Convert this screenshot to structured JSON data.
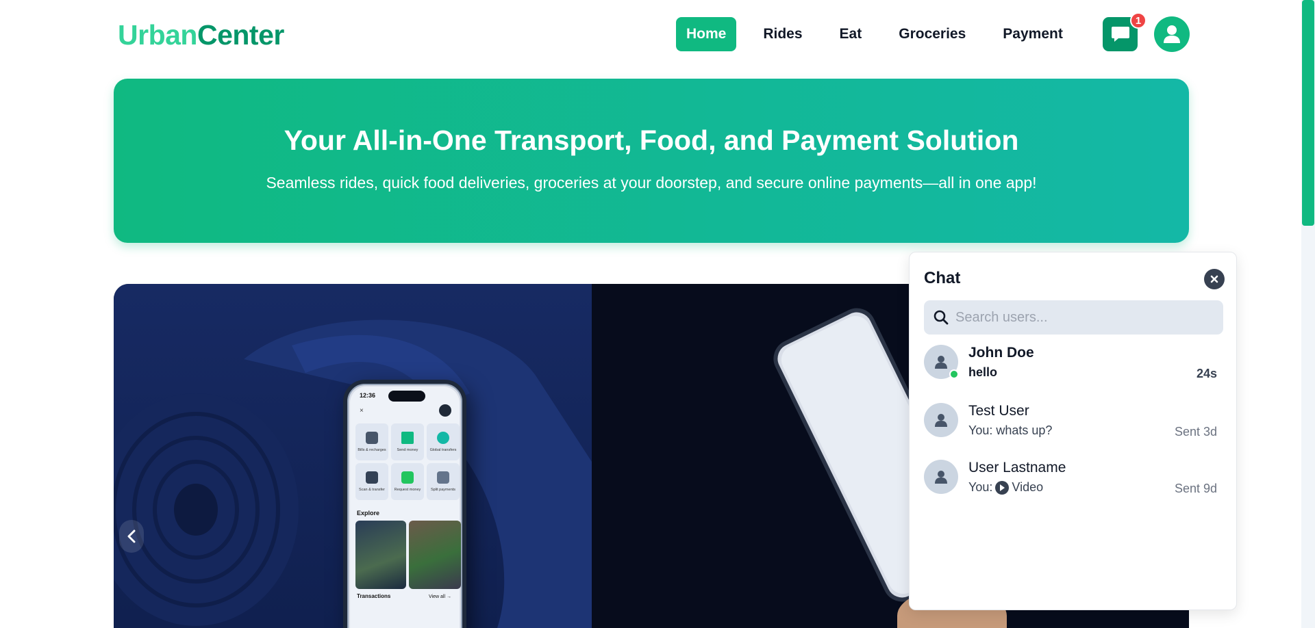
{
  "logo": {
    "part1": "Urban",
    "part2": "Center"
  },
  "nav": [
    {
      "label": "Home",
      "active": true
    },
    {
      "label": "Rides",
      "active": false
    },
    {
      "label": "Eat",
      "active": false
    },
    {
      "label": "Groceries",
      "active": false
    },
    {
      "label": "Payment",
      "active": false
    }
  ],
  "header": {
    "chat_badge": "1",
    "chat_icon": "message-icon",
    "profile_icon": "user-icon"
  },
  "hero": {
    "title": "Your All-in-One Transport, Food, and Payment Solution",
    "subtitle": "Seamless rides, quick food deliveries, groceries at your doorstep, and secure online payments—all in one app!"
  },
  "phone": {
    "time": "12:36",
    "tiles": [
      "Bills & recharges",
      "Send money",
      "Global transfers",
      "Scan & transfer",
      "Request money",
      "Split payments"
    ],
    "explore": "Explore",
    "transactions": "Transactions",
    "view_all": "View all →"
  },
  "chat": {
    "title": "Chat",
    "search_placeholder": "Search users...",
    "conversations": [
      {
        "name": "John Doe",
        "message": "hello",
        "time": "24s",
        "unread": true,
        "online": true
      },
      {
        "name": "Test User",
        "message": "You: whats up?",
        "time": "Sent 3d",
        "unread": false,
        "online": false
      },
      {
        "name": "User Lastname",
        "message_prefix": "You:",
        "message": "Video",
        "time": "Sent 9d",
        "unread": false,
        "online": false
      }
    ]
  },
  "colors": {
    "brand": "#10b981",
    "brand_dark": "#059669",
    "badge": "#ef4444"
  }
}
